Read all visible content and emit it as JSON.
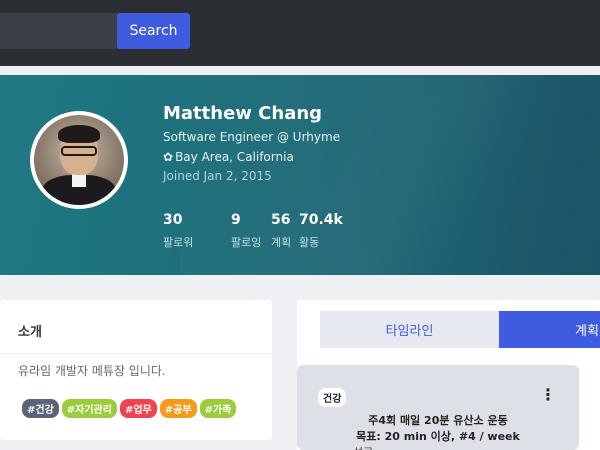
{
  "topbar": {
    "search_placeholder": "",
    "search_button": "Search"
  },
  "profile": {
    "name": "Matthew Chang",
    "title": "Software Engineer @ Urhyme",
    "location_icon": "✿",
    "location": "Bay Area, California",
    "joined": "Joined Jan 2, 2015",
    "stats": [
      {
        "value": "30",
        "label": "팔로워"
      },
      {
        "value": "9",
        "label": "팔로잉"
      },
      {
        "value": "56",
        "label": "계획"
      },
      {
        "value": "70.4k",
        "label": "활동"
      }
    ]
  },
  "intro": {
    "heading": "소개",
    "text": "유라임 개발자 메튜장 입니다.",
    "tags": [
      {
        "label": "#건강",
        "color": "#5b6478"
      },
      {
        "label": "#자기관리",
        "color": "#9ccc3c"
      },
      {
        "label": "#업무",
        "color": "#f0424f"
      },
      {
        "label": "#공부",
        "color": "#f59a1b"
      },
      {
        "label": "#가족",
        "color": "#9ccc3c"
      }
    ]
  },
  "tabs": {
    "timeline": "타임라인",
    "plan": "계획"
  },
  "plan_card": {
    "badge": "건강",
    "more_icon": "⋮",
    "title": "주4회 매일 20분 유산소 운동",
    "goal": "목표: 20 min 이상, #4 / week",
    "cut_text": "성공"
  },
  "colors": {
    "accent": "#3f5be0",
    "topbar": "#2b2e33",
    "hero_start": "#1f7a83",
    "hero_end": "#1b5466"
  }
}
